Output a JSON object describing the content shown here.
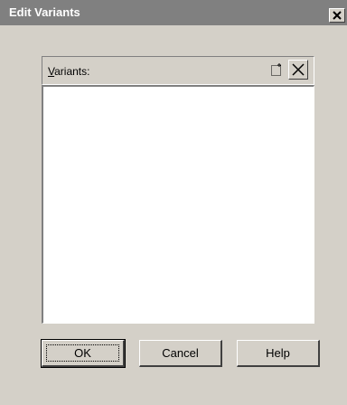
{
  "window": {
    "title": "Edit Variants"
  },
  "variants": {
    "label_prefix": "",
    "label_mnemonic": "V",
    "label_rest": "ariants:",
    "items": []
  },
  "buttons": {
    "ok": "OK",
    "cancel": "Cancel",
    "help": "Help"
  },
  "icons": {
    "close": "close-icon",
    "new": "new-item-icon",
    "delete": "delete-icon"
  },
  "colors": {
    "face": "#d4d0c8",
    "titlebar": "#808080",
    "list_bg": "#ffffff"
  }
}
